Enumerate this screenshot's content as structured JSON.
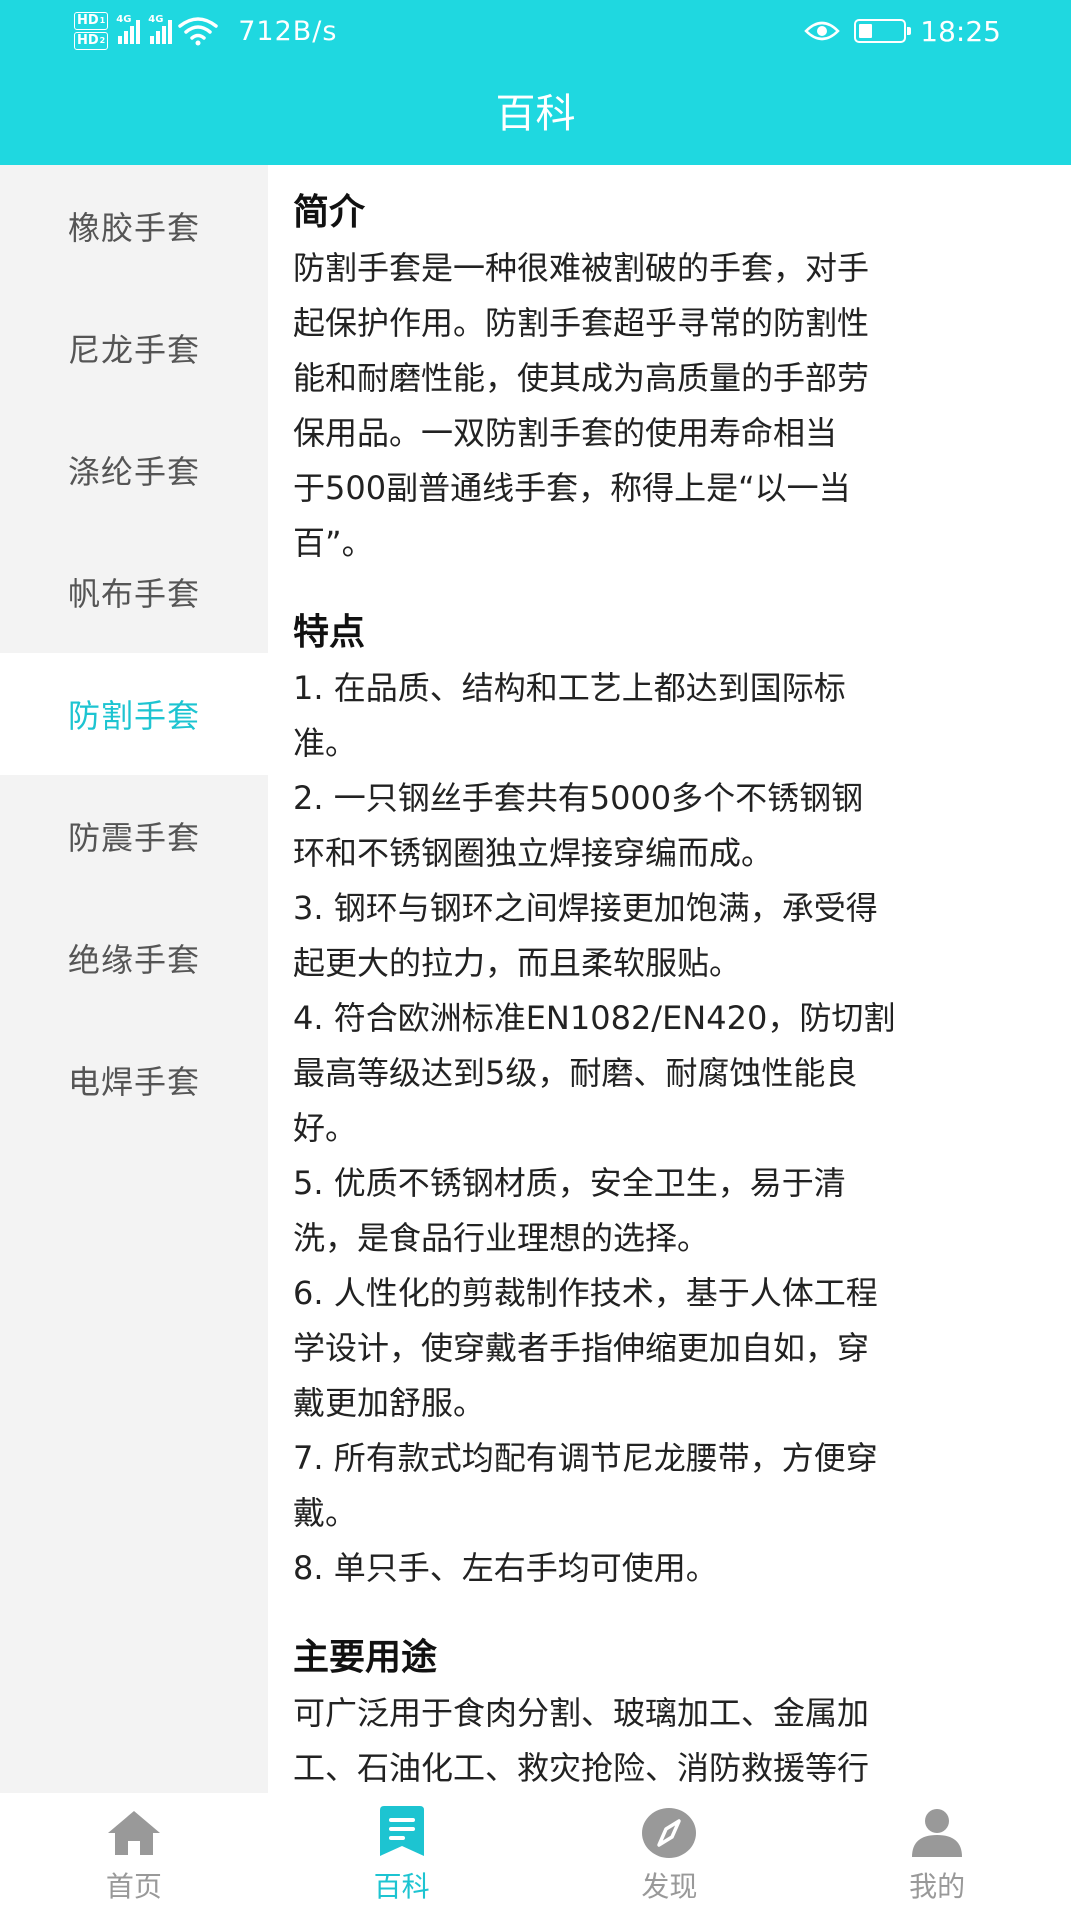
{
  "status_bar": {
    "hd1": "HD",
    "hd1_sub": "1",
    "hd2": "HD",
    "hd2_sub": "2",
    "net1": "4G",
    "net2": "4G",
    "net_speed": "712B/s",
    "time": "18:25",
    "battery_level": 0.3
  },
  "header": {
    "title": "百科"
  },
  "sidebar": {
    "items": [
      {
        "label": "橡胶手套"
      },
      {
        "label": "尼龙手套"
      },
      {
        "label": "涤纶手套"
      },
      {
        "label": "帆布手套"
      },
      {
        "label": "防割手套"
      },
      {
        "label": "防震手套"
      },
      {
        "label": "绝缘手套"
      },
      {
        "label": "电焊手套"
      }
    ],
    "active_index": 4
  },
  "content": {
    "intro_title": "简介",
    "intro_lines": [
      "防割手套是一种很难被割破的手套，对手",
      "起保护作用。防割手套超乎寻常的防割性",
      "能和耐磨性能，使其成为高质量的手部劳",
      "保用品。一双防割手套的使用寿命相当",
      "于500副普通线手套，称得上是“以一当",
      "百”。"
    ],
    "features_title": "特点",
    "features_lines": [
      "1. 在品质、结构和工艺上都达到国际标",
      "准。",
      "2. 一只钢丝手套共有5000多个不锈钢钢",
      "环和不锈钢圈独立焊接穿编而成。",
      "3. 钢环与钢环之间焊接更加饱满，承受得",
      "起更大的拉力，而且柔软服贴。",
      "4. 符合欧洲标准EN1082/EN420，防切割",
      "最高等级达到5级，耐磨、耐腐蚀性能良",
      "好。",
      "5. 优质不锈钢材质，安全卫生，易于清",
      "洗，是食品行业理想的选择。",
      "6. 人性化的剪裁制作技术，基于人体工程",
      "学设计，使穿戴者手指伸缩更加自如，穿",
      "戴更加舒服。",
      "7. 所有款式均配有调节尼龙腰带，方便穿",
      "戴。",
      "8. 单只手、左右手均可使用。"
    ],
    "usage_title": "主要用途",
    "usage_lines": [
      "可广泛用于食肉分割、玻璃加工、金属加",
      "工、石油化工、救灾抢险、消防救援等行"
    ]
  },
  "bottom_nav": {
    "items": [
      {
        "label": "首页",
        "icon": "home-icon"
      },
      {
        "label": "百科",
        "icon": "encyclopedia-icon"
      },
      {
        "label": "发现",
        "icon": "discover-icon"
      },
      {
        "label": "我的",
        "icon": "profile-icon"
      }
    ],
    "active_index": 1
  },
  "colors": {
    "accent": "#1fd8e0",
    "active_text": "#1dc4d1",
    "inactive_nav": "#999999",
    "sidebar_bg": "#f3f3f3"
  }
}
